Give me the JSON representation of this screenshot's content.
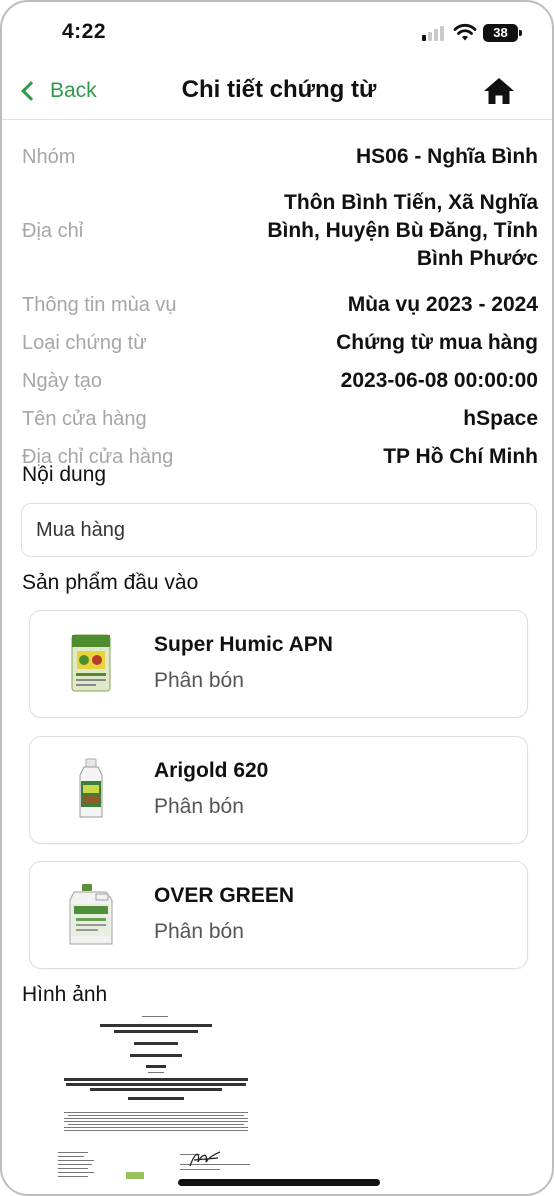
{
  "status_bar": {
    "time": "4:22",
    "battery": "38"
  },
  "nav": {
    "back_label": "Back",
    "title": "Chi tiết chứng từ"
  },
  "details": {
    "group_label": "Nhóm",
    "group_value": "HS06 - Nghĩa Bình",
    "address_label": "Địa chỉ",
    "address_value": "Thôn Bình Tiến, Xã Nghĩa Bình, Huyện Bù Đăng, Tỉnh Bình Phước",
    "season_label": "Thông tin mùa vụ",
    "season_value": "Mùa vụ 2023 - 2024",
    "doc_type_label": "Loại chứng từ",
    "doc_type_value": "Chứng từ mua hàng",
    "created_label": "Ngày tạo",
    "created_value": "2023-06-08 00:00:00",
    "store_label": "Tên cửa hàng",
    "store_value": "hSpace",
    "store_address_label": "Địa chỉ cửa hàng",
    "store_address_value": "TP Hồ Chí Minh"
  },
  "content": {
    "label": "Nội dung",
    "value": "Mua hàng"
  },
  "products": {
    "label": "Sản phẩm đầu vào",
    "items": [
      {
        "name": "Super Humic APN",
        "type": "Phân bón",
        "icon": "fertilizer-bag-icon"
      },
      {
        "name": "Arigold 620",
        "type": "Phân bón",
        "icon": "fertilizer-bottle-icon"
      },
      {
        "name": "OVER GREEN",
        "type": "Phân bón",
        "icon": "fertilizer-jug-icon"
      }
    ]
  },
  "images": {
    "label": "Hình ảnh"
  },
  "colors": {
    "accent": "#2f9a47",
    "label_gray": "#a6a6a6"
  }
}
